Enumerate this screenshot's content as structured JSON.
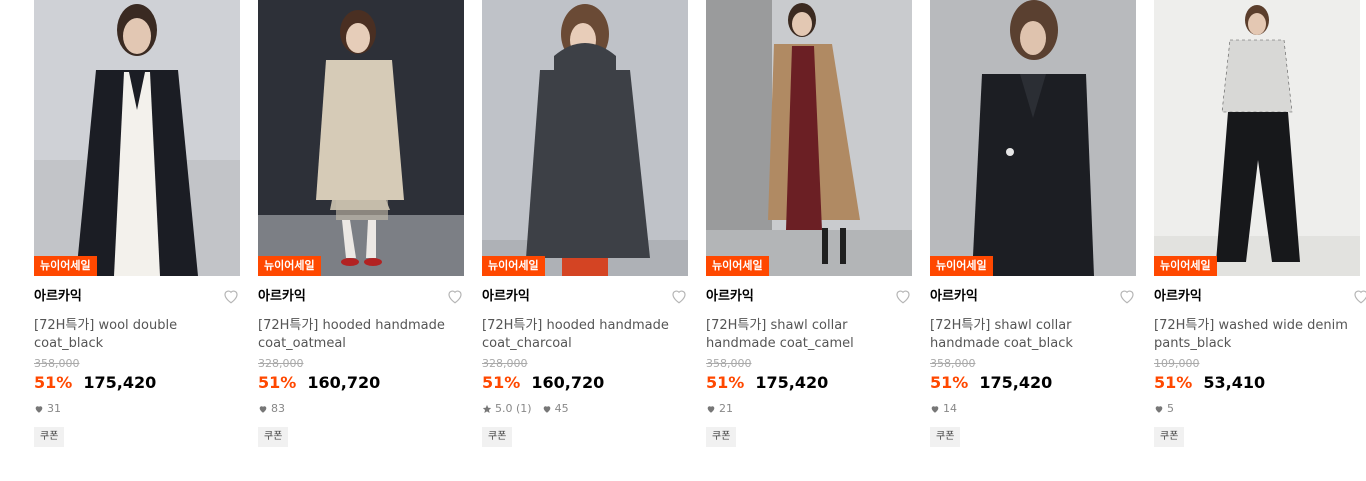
{
  "colors": {
    "accent": "#ff4800",
    "badge_bg": "#ff4800",
    "text_primary": "#000000",
    "text_secondary": "#555555"
  },
  "products": [
    {
      "badge": "뉴이어세일",
      "brand": "아르카익",
      "name": "[72H특가] wool double coat_black",
      "original_price": "358,000",
      "discount": "51%",
      "price": "175,420",
      "rating": "",
      "likes": "31",
      "coupon": "쿠폰",
      "image": "model in long black double coat over white dress"
    },
    {
      "badge": "뉴이어세일",
      "brand": "아르카익",
      "name": "[72H특가] hooded handmade coat_oatmeal",
      "original_price": "328,000",
      "discount": "51%",
      "price": "160,720",
      "rating": "",
      "likes": "83",
      "coupon": "쿠폰",
      "image": "model in oatmeal hooded coat with sequin skirt and red shoes"
    },
    {
      "badge": "뉴이어세일",
      "brand": "아르카익",
      "name": "[72H특가] hooded handmade coat_charcoal",
      "original_price": "328,000",
      "discount": "51%",
      "price": "160,720",
      "rating": "5.0 (1)",
      "likes": "45",
      "coupon": "쿠폰",
      "image": "model in charcoal hooded coat"
    },
    {
      "badge": "뉴이어세일",
      "brand": "아르카익",
      "name": "[72H특가] shawl collar handmade coat_camel",
      "original_price": "358,000",
      "discount": "51%",
      "price": "175,420",
      "rating": "",
      "likes": "21",
      "coupon": "쿠폰",
      "image": "model in camel shawl collar coat leaning on pillar"
    },
    {
      "badge": "뉴이어세일",
      "brand": "아르카익",
      "name": "[72H특가] shawl collar handmade coat_black",
      "original_price": "358,000",
      "discount": "51%",
      "price": "175,420",
      "rating": "",
      "likes": "14",
      "coupon": "쿠폰",
      "image": "model in black shawl collar coat"
    },
    {
      "badge": "뉴이어세일",
      "brand": "아르카익",
      "name": "[72H특가] washed wide denim pants_black",
      "original_price": "109,000",
      "discount": "51%",
      "price": "53,410",
      "rating": "",
      "likes": "5",
      "coupon": "쿠폰",
      "image": "model in plaid shirt and black wide denim pants"
    }
  ]
}
